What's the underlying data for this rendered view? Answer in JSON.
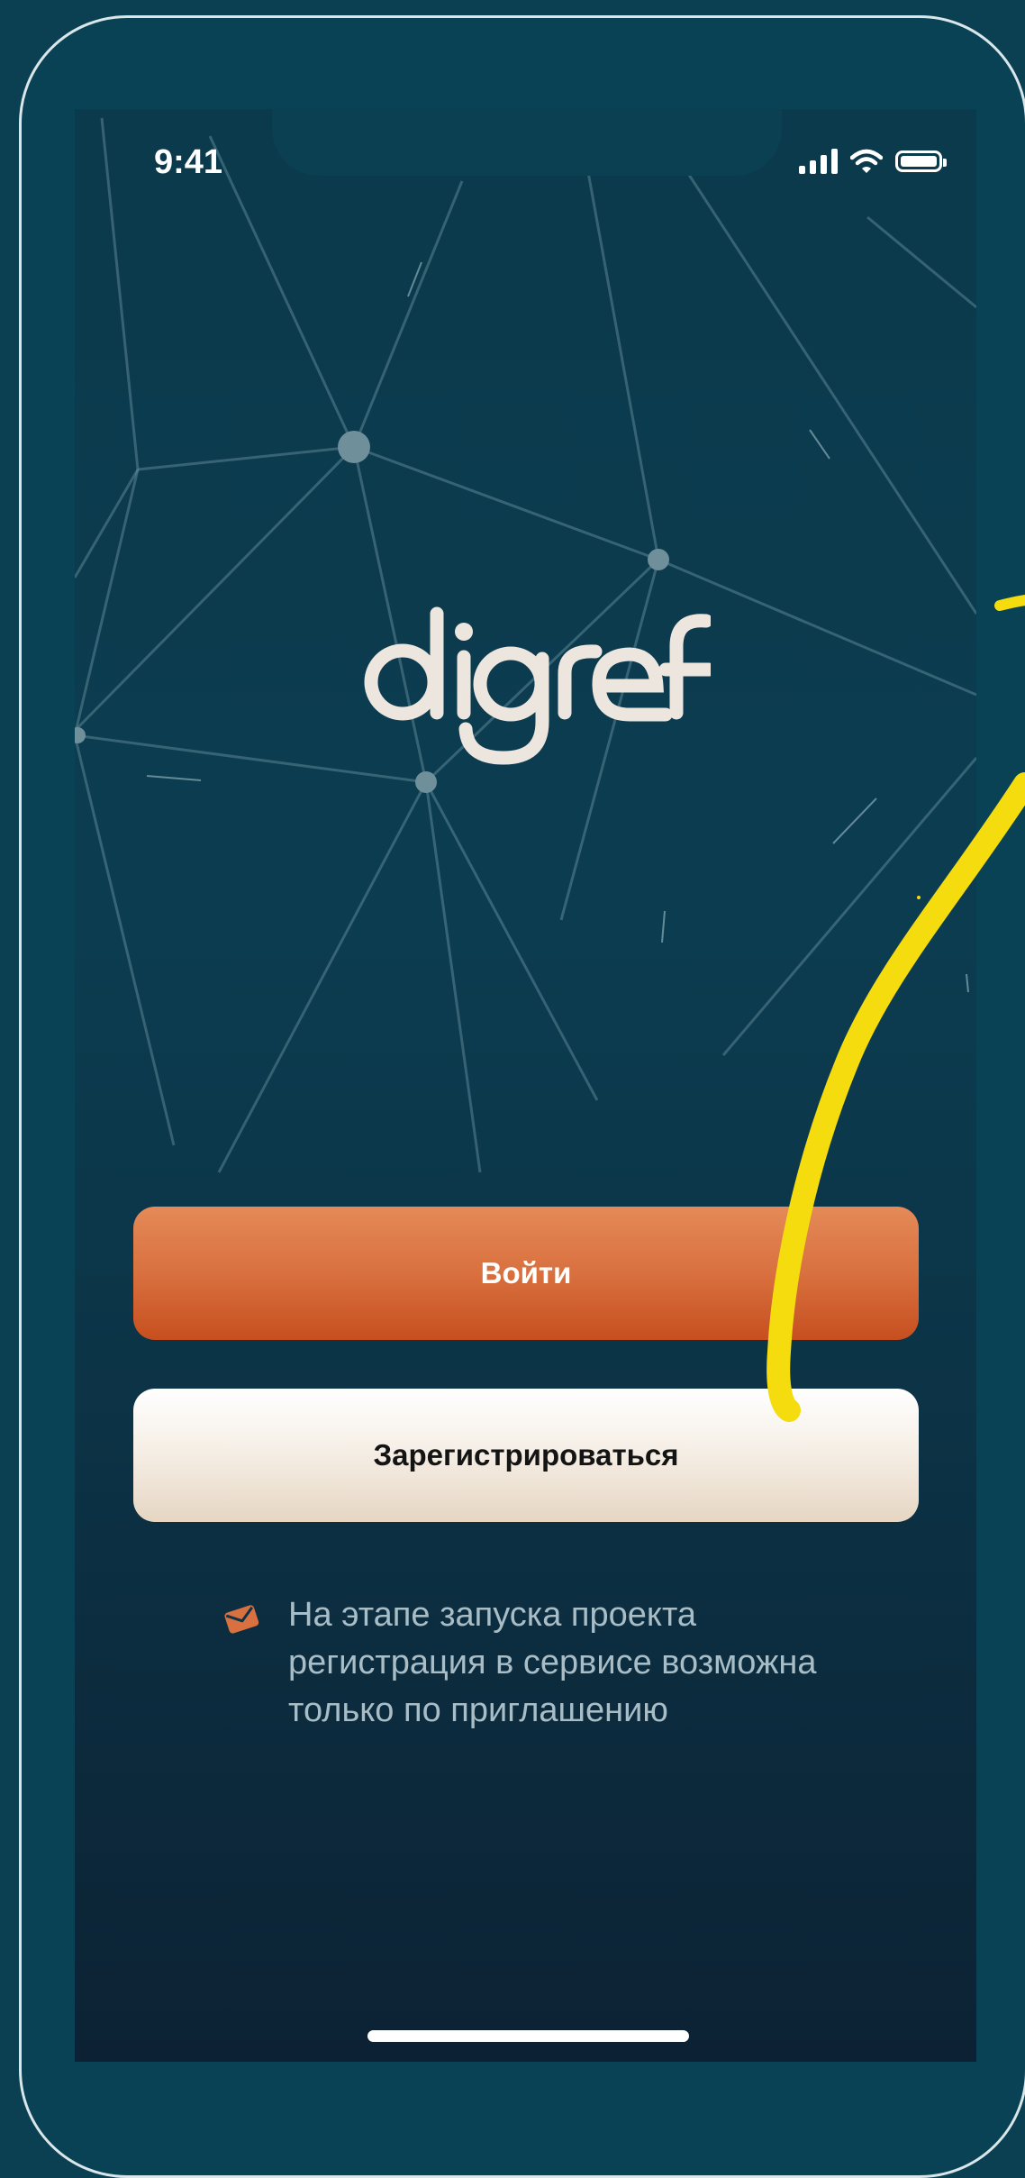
{
  "status_bar": {
    "time": "9:41",
    "signal_icon": "cellular-signal-icon",
    "wifi_icon": "wifi-icon",
    "battery_icon": "battery-icon"
  },
  "brand": {
    "logo_text": "digref",
    "accent_color": "#d9703f",
    "logo_color": "#ece6df"
  },
  "actions": {
    "login_label": "Войти",
    "register_label": "Зарегистрироваться"
  },
  "notice": {
    "icon": "envelope-icon",
    "text": "На этапе запуска проекта\nрегистрация в сервисе  возможна\nтолько по приглашению"
  }
}
